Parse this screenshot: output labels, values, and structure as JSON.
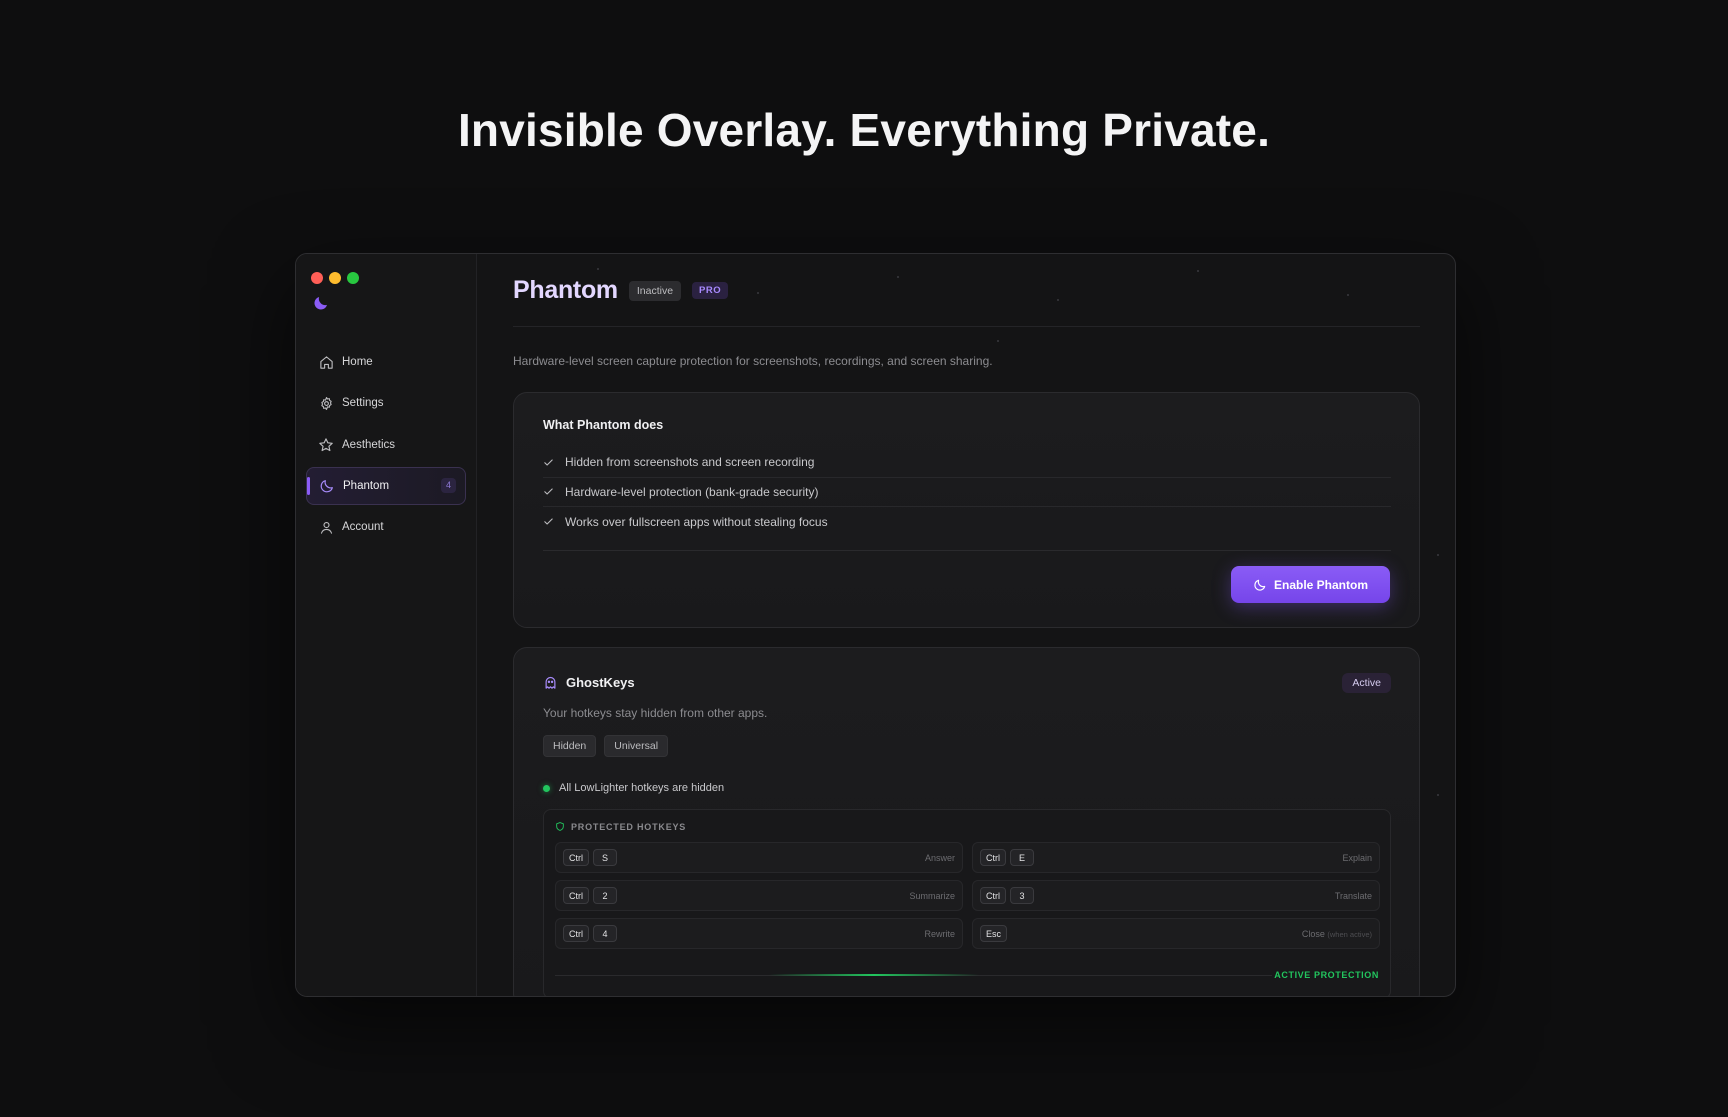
{
  "headline": "Invisible Overlay. Everything Private.",
  "sidebar": {
    "items": [
      {
        "label": "Home",
        "icon": "home-icon"
      },
      {
        "label": "Settings",
        "icon": "gear-icon"
      },
      {
        "label": "Aesthetics",
        "icon": "star-icon"
      },
      {
        "label": "Phantom",
        "icon": "moon-icon",
        "badge": "4",
        "active": true
      },
      {
        "label": "Account",
        "icon": "user-icon"
      }
    ]
  },
  "header": {
    "title": "Phantom",
    "status_chip": "Inactive",
    "tier_chip": "PRO"
  },
  "subtitle": "Hardware-level screen capture protection for screenshots, recordings, and screen sharing.",
  "what_card": {
    "heading": "What Phantom does",
    "features": [
      "Hidden from screenshots and screen recording",
      "Hardware-level protection (bank-grade security)",
      "Works over fullscreen apps without stealing focus"
    ],
    "button_label": "Enable Phantom"
  },
  "ghostkeys": {
    "title": "GhostKeys",
    "status": "Active",
    "description": "Your hotkeys stay hidden from other apps.",
    "tags": [
      "Hidden",
      "Universal"
    ],
    "status_line": "All LowLighter hotkeys are hidden",
    "panel_label": "PROTECTED HOTKEYS",
    "hotkeys": [
      {
        "keys": [
          "Ctrl",
          "S"
        ],
        "action": "Answer",
        "note": ""
      },
      {
        "keys": [
          "Ctrl",
          "E"
        ],
        "action": "Explain",
        "note": ""
      },
      {
        "keys": [
          "Ctrl",
          "2"
        ],
        "action": "Summarize",
        "note": ""
      },
      {
        "keys": [
          "Ctrl",
          "3"
        ],
        "action": "Translate",
        "note": ""
      },
      {
        "keys": [
          "Ctrl",
          "4"
        ],
        "action": "Rewrite",
        "note": ""
      },
      {
        "keys": [
          "Esc"
        ],
        "action": "Close",
        "note": "(when active)"
      }
    ],
    "footer_label": "ACTIVE PROTECTION"
  },
  "colors": {
    "accent": "#8b5cf6",
    "title": "#e3d7ff",
    "success": "#22c55e",
    "background": "#0e0e0f"
  }
}
